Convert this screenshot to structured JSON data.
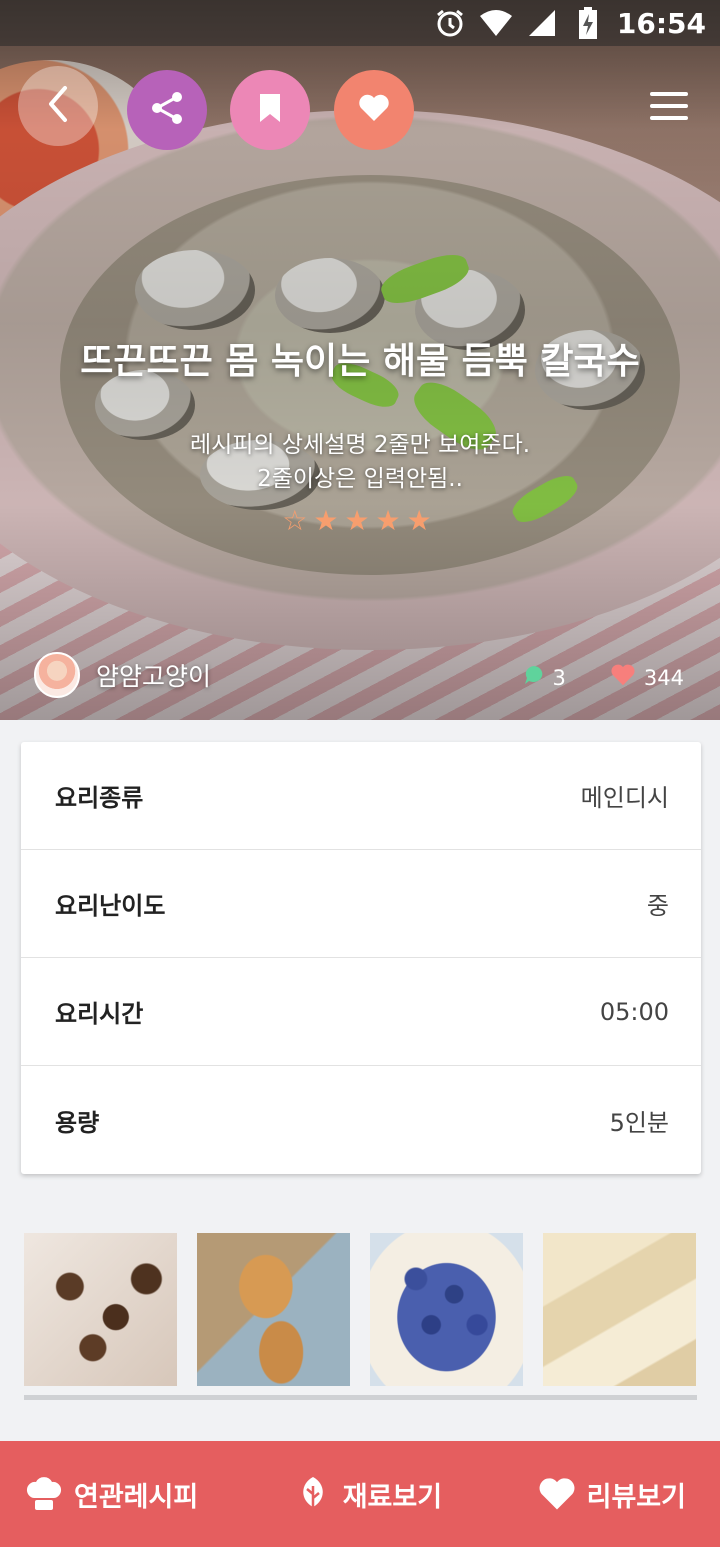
{
  "status_bar": {
    "time": "16:54",
    "icons": [
      "alarm-icon",
      "wifi-icon",
      "signal-icon",
      "battery-charging-icon"
    ]
  },
  "header": {
    "buttons": [
      {
        "name": "back",
        "icon": "chevron-left-icon"
      },
      {
        "name": "share",
        "icon": "share-icon",
        "color": "#b762b9"
      },
      {
        "name": "bookmark",
        "icon": "bookmark-icon",
        "color": "#ec87b6"
      },
      {
        "name": "favorite",
        "icon": "heart-icon",
        "color": "#f2846f"
      },
      {
        "name": "menu",
        "icon": "hamburger-menu-icon"
      }
    ]
  },
  "recipe": {
    "title": "뜨끈뜨끈 몸 녹이는 해물 듬뿍 칼국수",
    "description_line1": "레시피의 상세설명 2줄만 보여준다.",
    "description_line2": "2줄이상은 입력안됨..",
    "rating": 4,
    "rating_max": 5,
    "author": "얌얌고양이",
    "comment_count": "3",
    "like_count": "344"
  },
  "info": {
    "rows": [
      {
        "label": "요리종류",
        "value": "메인디시"
      },
      {
        "label": "요리난이도",
        "value": "중"
      },
      {
        "label": "요리시간",
        "value": "05:00"
      },
      {
        "label": "용량",
        "value": "5인분"
      }
    ]
  },
  "thumbnails": [
    "coffee-beans-image",
    "bread-image",
    "blueberry-cake-image",
    "white-chocolate-image"
  ],
  "bottom_bar": {
    "items": [
      {
        "label": "연관레시피",
        "icon": "chef-hat-icon"
      },
      {
        "label": "재료보기",
        "icon": "leaf-icon"
      },
      {
        "label": "리뷰보기",
        "icon": "heart-icon"
      }
    ],
    "color": "#e55e5f"
  }
}
